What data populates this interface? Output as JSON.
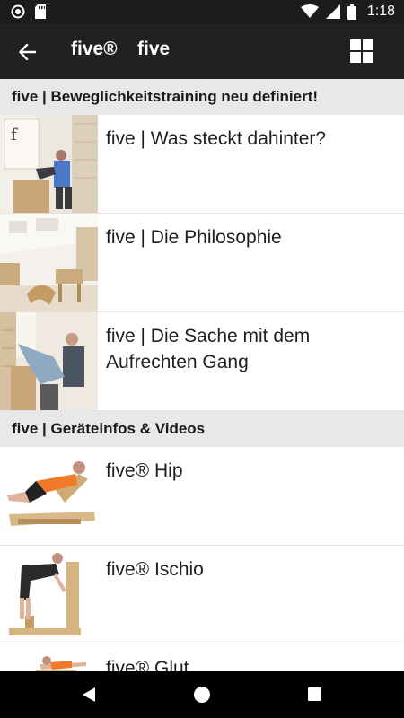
{
  "status_bar": {
    "time": "1:18",
    "icons": [
      "notification-circle-icon",
      "sd-card-icon",
      "wifi-icon",
      "signal-icon",
      "battery-icon"
    ]
  },
  "app_bar": {
    "title": "five®",
    "subtitle": "five",
    "back_icon": "arrow-back-icon",
    "grid_icon": "grid-view-icon"
  },
  "sections": [
    {
      "header": "five | Beweglichkeitstraining neu definiert!",
      "items": [
        {
          "label": "five | Was steckt dahinter?",
          "thumb": "studio-trainer-photo"
        },
        {
          "label": "five | Die Philosophie",
          "thumb": "studio-room-photo"
        },
        {
          "label": "five | Die Sache mit dem Aufrechten Gang",
          "thumb": "trainer-stretch-photo"
        }
      ]
    },
    {
      "header": "five | Geräteinfos & Videos",
      "items": [
        {
          "label": "five® Hip",
          "thumb": "hip-device-photo"
        },
        {
          "label": "five® Ischio",
          "thumb": "ischio-device-photo"
        },
        {
          "label": "five® Glut",
          "thumb": "glut-device-photo"
        }
      ]
    }
  ],
  "nav_bar": {
    "icons": [
      "nav-back-icon",
      "nav-home-icon",
      "nav-recents-icon"
    ]
  }
}
